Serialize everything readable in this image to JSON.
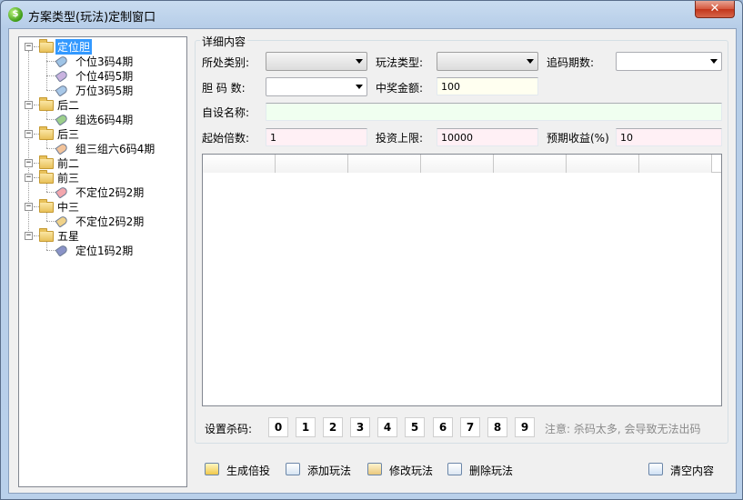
{
  "window": {
    "title": "方案类型(玩法)定制窗口",
    "close_label": "✕"
  },
  "tree": {
    "groups": [
      {
        "label": "定位胆",
        "selected": true,
        "children": [
          {
            "label": "个位3码4期",
            "color": "#9fc4e6"
          },
          {
            "label": "个位4码5期",
            "color": "#c9b3e0"
          },
          {
            "label": "万位3码5期",
            "color": "#a8c8e8"
          }
        ]
      },
      {
        "label": "后二",
        "children": [
          {
            "label": "组选6码4期",
            "color": "#9ccf8b"
          }
        ]
      },
      {
        "label": "后三",
        "children": [
          {
            "label": "组三组六6码4期",
            "color": "#f2c39a"
          }
        ]
      },
      {
        "label": "前二",
        "children": []
      },
      {
        "label": "前三",
        "children": [
          {
            "label": "不定位2码2期",
            "color": "#f3a7ae"
          }
        ]
      },
      {
        "label": "中三",
        "children": [
          {
            "label": "不定位2码2期",
            "color": "#f0d28a"
          }
        ]
      },
      {
        "label": "五星",
        "children": [
          {
            "label": "定位1码2期",
            "color": "#8a93c7"
          }
        ]
      }
    ]
  },
  "details": {
    "caption": "详细内容",
    "category_label": "所处类别:",
    "category_value": "",
    "play_type_label": "玩法类型:",
    "play_type_value": "",
    "chase_periods_label": "追码期数:",
    "chase_periods_value": "",
    "dan_count_label": "胆 码 数:",
    "dan_count_value": "",
    "prize_label": "中奖金额:",
    "prize_value": "100",
    "custom_name_label": "自设名称:",
    "custom_name_value": "",
    "start_multiple_label": "起始倍数:",
    "start_multiple_value": "1",
    "invest_limit_label": "投资上限:",
    "invest_limit_value": "10000",
    "expected_return_label": "预期收益(%)",
    "expected_return_value": "10"
  },
  "kill_codes": {
    "label": "设置杀码:",
    "digits": [
      "0",
      "1",
      "2",
      "3",
      "4",
      "5",
      "6",
      "7",
      "8",
      "9"
    ],
    "note": "注意: 杀码太多, 会导致无法出码"
  },
  "toolbar": {
    "generate_label": "生成倍投",
    "add_label": "添加玩法",
    "edit_label": "修改玩法",
    "delete_label": "删除玩法",
    "clear_label": "清空内容"
  },
  "colors": {
    "selected": "#3399ff",
    "prize_bg": "#fffff0",
    "name_bg": "#f0fff0",
    "pink_bg": "#fff0f5"
  }
}
